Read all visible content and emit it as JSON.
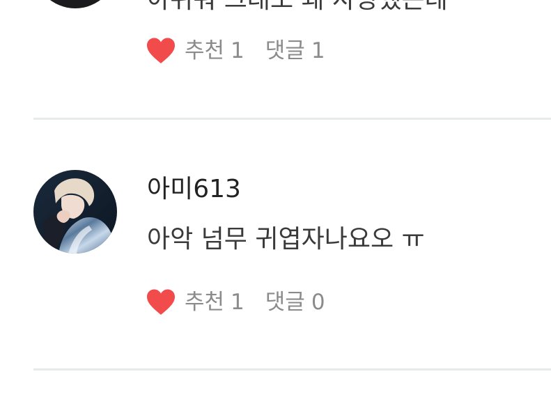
{
  "previous_comment": {
    "partial_text": "아쉬워 그래도 왜 사랑했는데",
    "stats": {
      "recommend_label": "추천",
      "recommend_count": "1",
      "reply_label": "댓글",
      "reply_count": "1"
    }
  },
  "comment": {
    "username": "아미613",
    "text": "아악 넘무 귀엽자나요오 ㅠ",
    "stats": {
      "recommend_label": "추천",
      "recommend_count": "1",
      "reply_label": "댓글",
      "reply_count": "0"
    }
  },
  "colors": {
    "heart": "#f24b4b",
    "stat_text": "#8b8b8b",
    "divider": "#e6ebea",
    "body_text": "#3a3a3a"
  }
}
